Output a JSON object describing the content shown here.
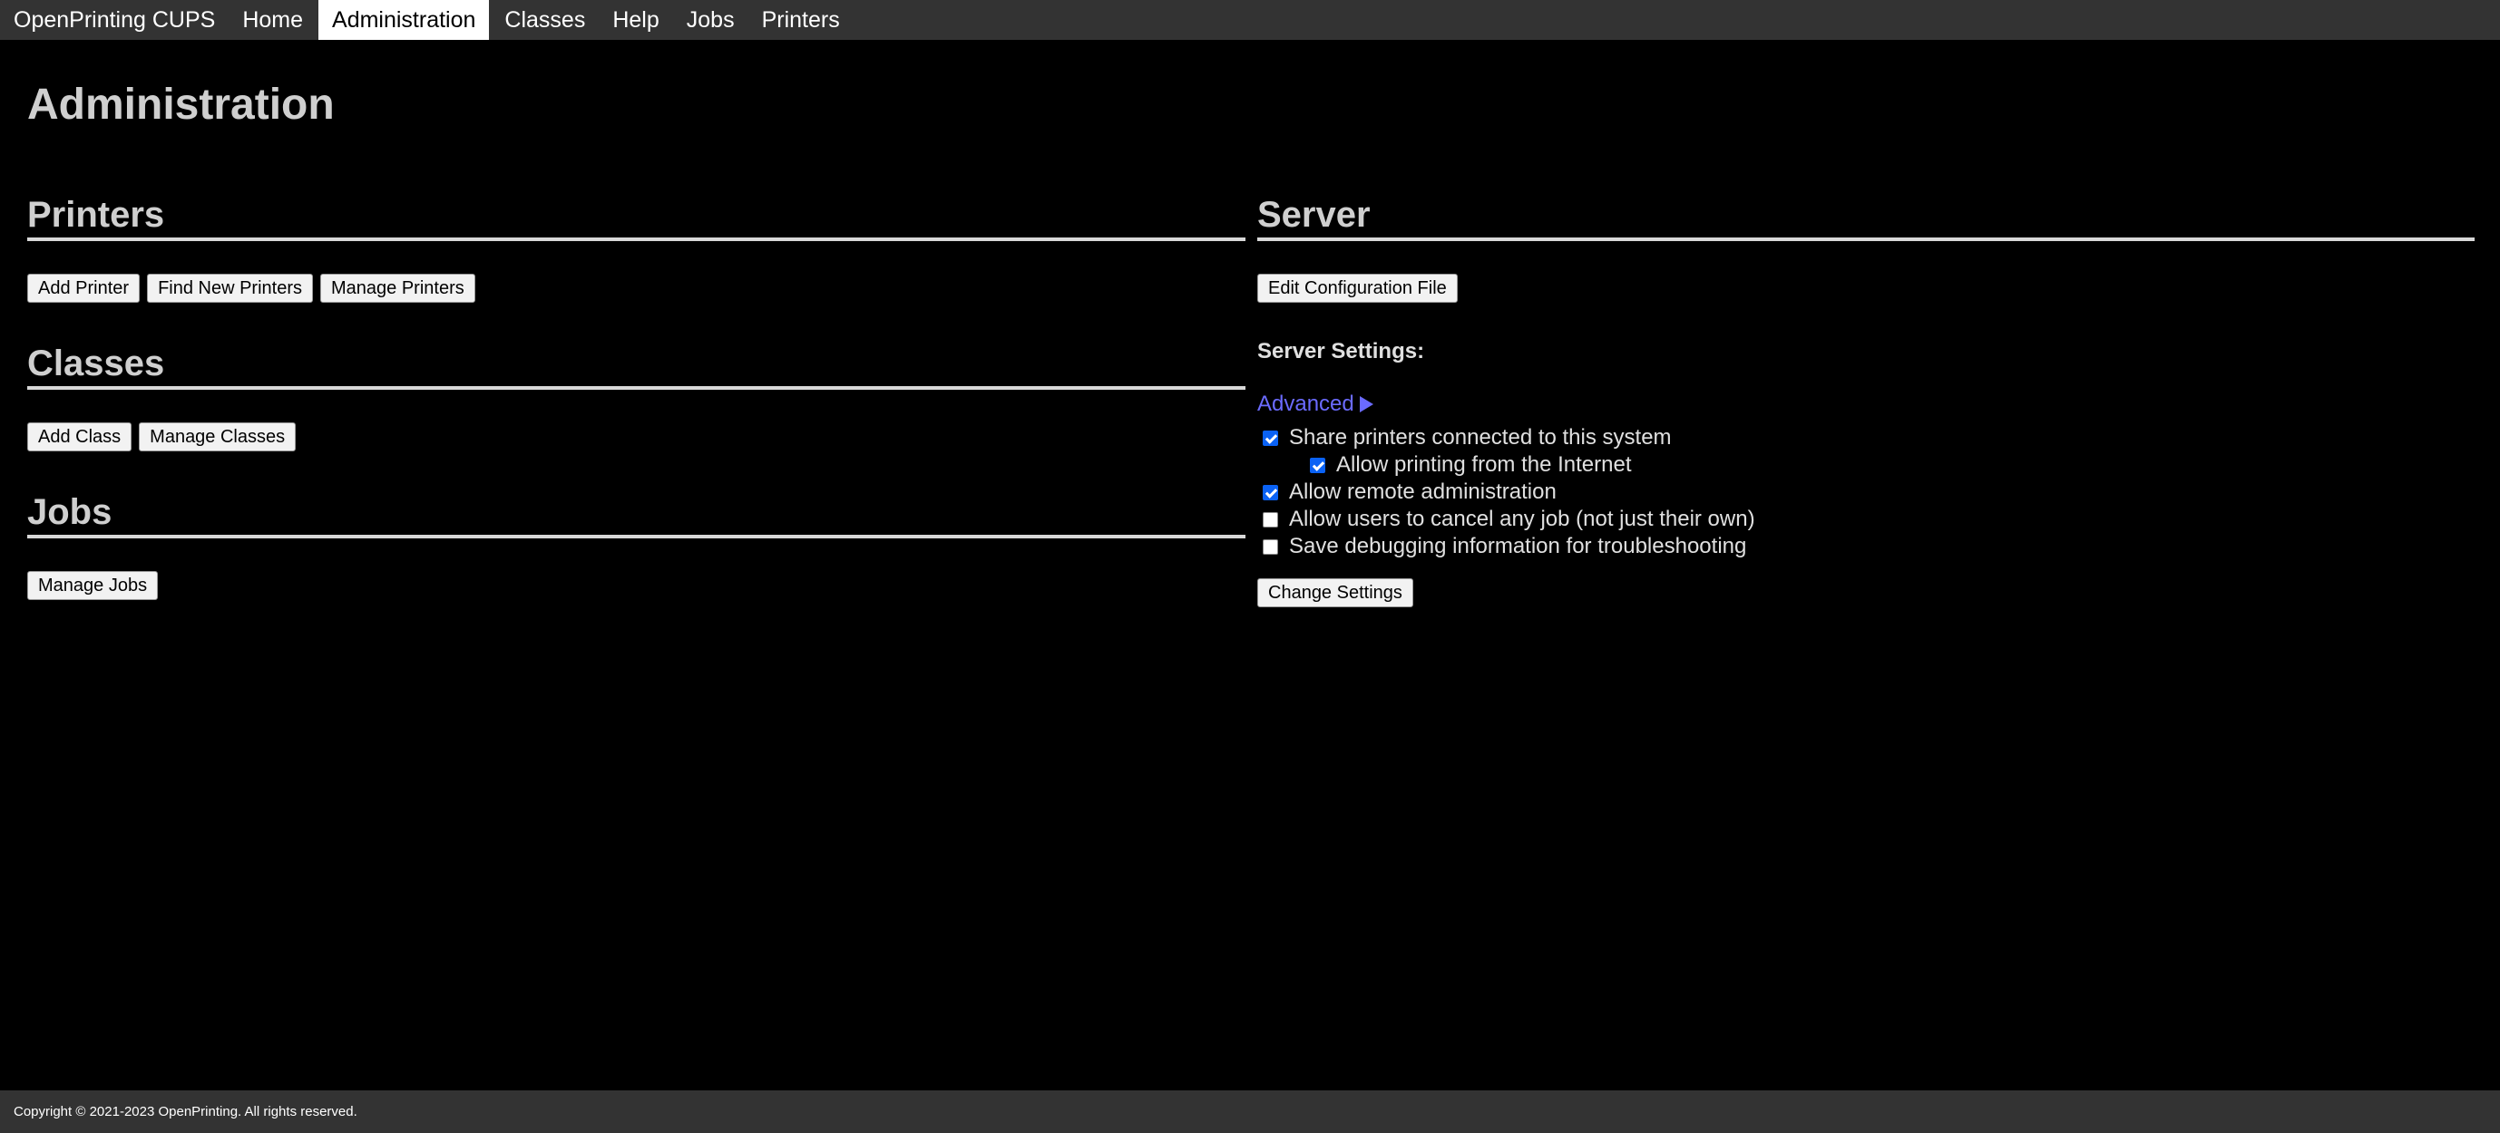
{
  "nav": {
    "brand": "OpenPrinting CUPS",
    "items": [
      {
        "label": "Home"
      },
      {
        "label": "Administration"
      },
      {
        "label": "Classes"
      },
      {
        "label": "Help"
      },
      {
        "label": "Jobs"
      },
      {
        "label": "Printers"
      }
    ],
    "active": "Administration"
  },
  "page": {
    "title": "Administration"
  },
  "printers": {
    "heading": "Printers",
    "buttons": [
      "Add Printer",
      "Find New Printers",
      "Manage Printers"
    ]
  },
  "classes": {
    "heading": "Classes",
    "buttons": [
      "Add Class",
      "Manage Classes"
    ]
  },
  "jobs": {
    "heading": "Jobs",
    "buttons": [
      "Manage Jobs"
    ]
  },
  "server": {
    "heading": "Server",
    "edit_config_label": "Edit Configuration File",
    "settings_label": "Server Settings:",
    "advanced_label": "Advanced",
    "options": [
      {
        "label": "Share printers connected to this system",
        "checked": true
      },
      {
        "label": "Allow printing from the Internet",
        "checked": true
      },
      {
        "label": "Allow remote administration",
        "checked": true
      },
      {
        "label": "Allow users to cancel any job (not just their own)",
        "checked": false
      },
      {
        "label": "Save debugging information for troubleshooting",
        "checked": false
      }
    ],
    "change_settings_label": "Change Settings"
  },
  "footer": {
    "copyright": "Copyright © 2021-2023 OpenPrinting. All rights reserved."
  },
  "colors": {
    "background": "#000000",
    "nav_bar": "#333333",
    "link": "#6b6bff",
    "checkbox_checked": "#0a62f5"
  }
}
